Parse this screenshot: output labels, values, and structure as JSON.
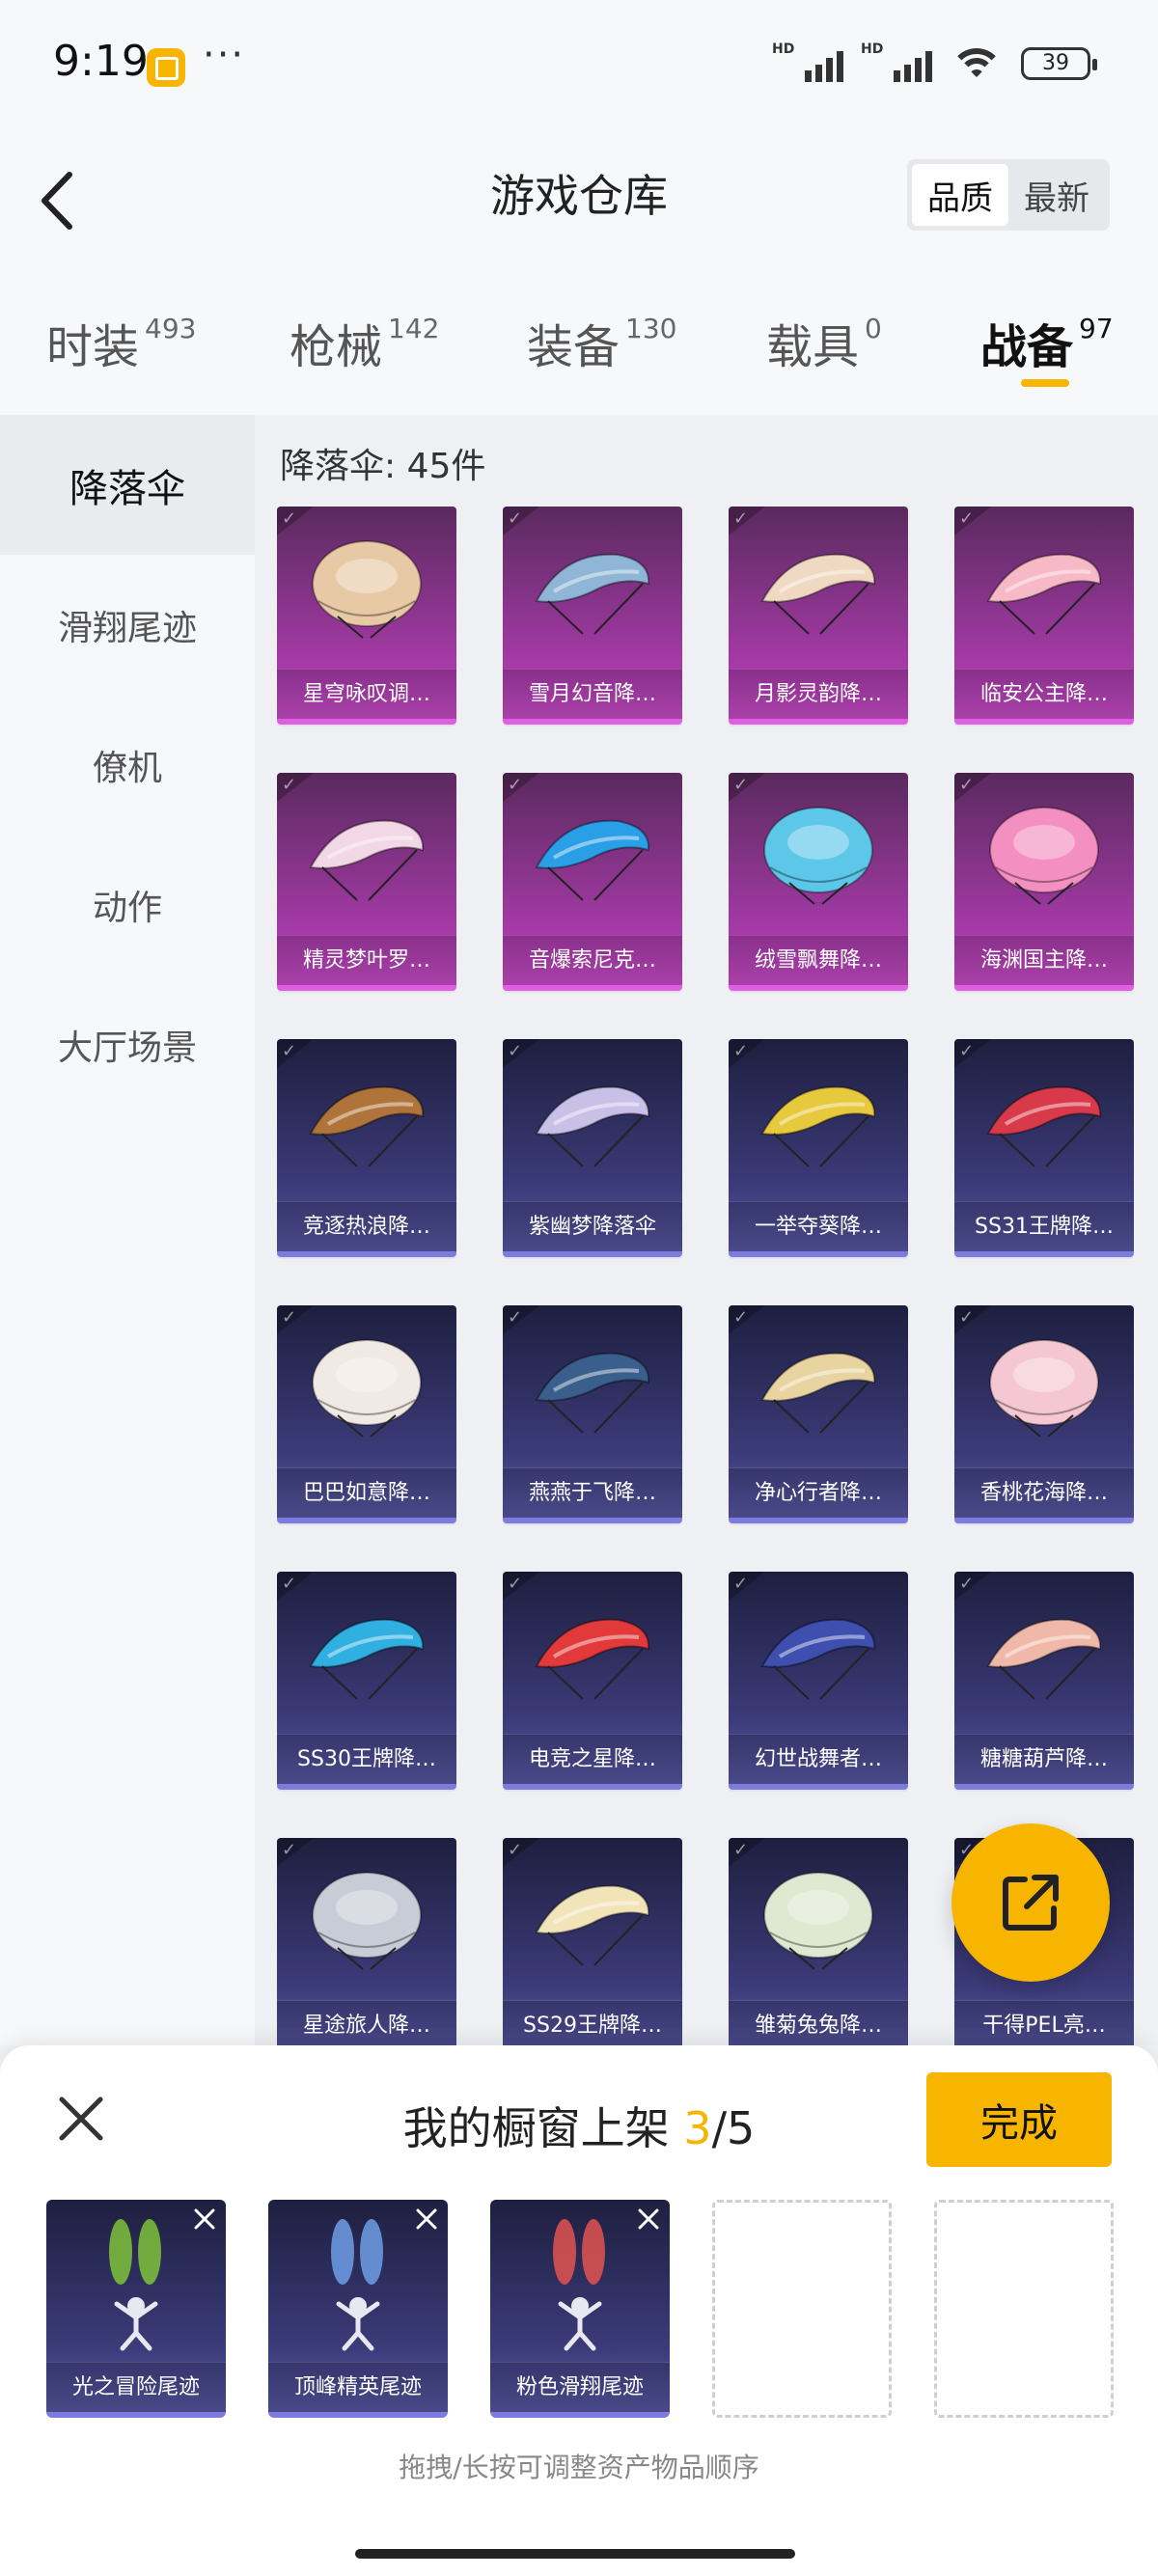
{
  "status": {
    "time": "9:19",
    "battery": "39",
    "sim1": "HD",
    "sim2": "HD"
  },
  "header": {
    "title": "游戏仓库",
    "sort_quality": "品质",
    "sort_latest": "最新"
  },
  "tabs": [
    {
      "label": "时装",
      "count": "493"
    },
    {
      "label": "枪械",
      "count": "142"
    },
    {
      "label": "装备",
      "count": "130"
    },
    {
      "label": "载具",
      "count": "0"
    },
    {
      "label": "战备",
      "count": "97"
    }
  ],
  "sidebar": {
    "items": [
      "降落伞",
      "滑翔尾迹",
      "僚机",
      "动作",
      "大厅场景"
    ]
  },
  "main": {
    "count_label": "降落伞: 45件",
    "items": [
      {
        "name": "星穹咏叹调…",
        "rarity": "pink",
        "color": "#e8c9a6",
        "shape": "round"
      },
      {
        "name": "雪月幻音降…",
        "rarity": "pink",
        "color": "#8fb6d6",
        "shape": "wing"
      },
      {
        "name": "月影灵韵降…",
        "rarity": "pink",
        "color": "#f0d9c2",
        "shape": "wing"
      },
      {
        "name": "临安公主降…",
        "rarity": "pink",
        "color": "#f7b9c6",
        "shape": "wing"
      },
      {
        "name": "精灵梦叶罗…",
        "rarity": "pink",
        "color": "#f2d8e6",
        "shape": "wing"
      },
      {
        "name": "音爆索尼克…",
        "rarity": "pink",
        "color": "#2a9ee6",
        "shape": "wing"
      },
      {
        "name": "绒雪飘舞降…",
        "rarity": "pink",
        "color": "#5cc7e8",
        "shape": "round"
      },
      {
        "name": "海渊国主降…",
        "rarity": "pink",
        "color": "#f38fc1",
        "shape": "round"
      },
      {
        "name": "竞逐热浪降…",
        "rarity": "purple",
        "color": "#b0743a",
        "shape": "wing"
      },
      {
        "name": "紫幽梦降落伞",
        "rarity": "purple",
        "color": "#c9c0e8",
        "shape": "wing"
      },
      {
        "name": "一举夺葵降…",
        "rarity": "purple",
        "color": "#e7c93e",
        "shape": "wing"
      },
      {
        "name": "SS31王牌降…",
        "rarity": "purple",
        "color": "#d83a4a",
        "shape": "wing"
      },
      {
        "name": "巴巴如意降…",
        "rarity": "purple",
        "color": "#f1e9e4",
        "shape": "round"
      },
      {
        "name": "燕燕于飞降…",
        "rarity": "purple",
        "color": "#3a5f8c",
        "shape": "wing"
      },
      {
        "name": "净心行者降…",
        "rarity": "purple",
        "color": "#e8d4a0",
        "shape": "wing"
      },
      {
        "name": "香桃花海降…",
        "rarity": "purple",
        "color": "#f4c7d2",
        "shape": "round"
      },
      {
        "name": "SS30王牌降…",
        "rarity": "purple",
        "color": "#2fb0e0",
        "shape": "wing"
      },
      {
        "name": "电竞之星降…",
        "rarity": "purple",
        "color": "#e23a3a",
        "shape": "wing"
      },
      {
        "name": "幻世战舞者…",
        "rarity": "purple",
        "color": "#3e4fb0",
        "shape": "wing"
      },
      {
        "name": "糖糖葫芦降…",
        "rarity": "purple",
        "color": "#f0b8a8",
        "shape": "wing"
      },
      {
        "name": "星途旅人降…",
        "rarity": "purple",
        "color": "#c7ccd6",
        "shape": "round"
      },
      {
        "name": "SS29王牌降…",
        "rarity": "purple",
        "color": "#f0e4b8",
        "shape": "wing"
      },
      {
        "name": "雏菊兔兔降…",
        "rarity": "purple",
        "color": "#dfe8d0",
        "shape": "round"
      },
      {
        "name": "干得PEL亮…",
        "rarity": "purple",
        "color": "#5b5da8",
        "shape": "wing"
      }
    ]
  },
  "sheet": {
    "title_prefix": "我的橱窗上架 ",
    "current": "3",
    "total": "/5",
    "done": "完成",
    "slots": [
      {
        "name": "光之冒险尾迹",
        "smoke": "#7fc23a"
      },
      {
        "name": "顶峰精英尾迹",
        "smoke": "#6f9fe6"
      },
      {
        "name": "粉色滑翔尾迹",
        "smoke": "#e2534f"
      }
    ],
    "empty_slots": 2,
    "hint": "拖拽/长按可调整资产物品顺序"
  },
  "colors": {
    "accent": "#f7b500"
  }
}
